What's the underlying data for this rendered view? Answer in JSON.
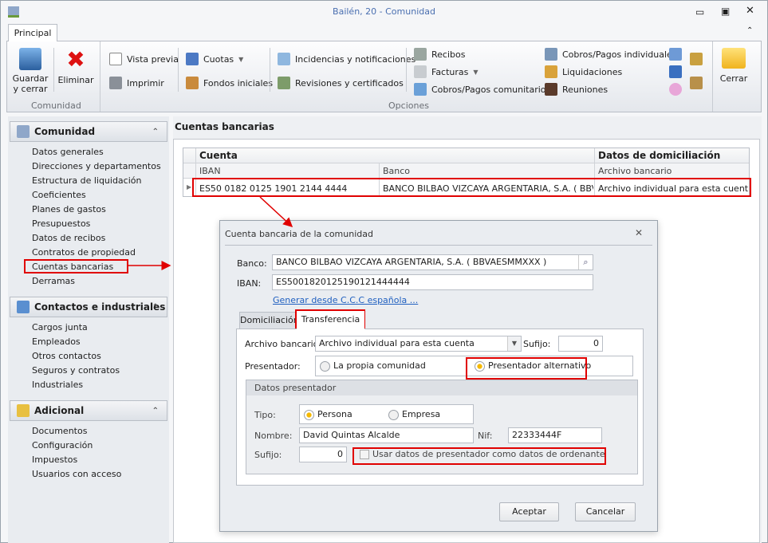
{
  "window": {
    "title": "Bailén, 20 - Comunidad",
    "tab": "Principal"
  },
  "ribbon": {
    "guardar": "Guardar y cerrar",
    "eliminar": "Eliminar",
    "group1": "Comunidad",
    "vista_previa": "Vista previa",
    "imprimir": "Imprimir",
    "cuotas": "Cuotas",
    "fondos": "Fondos iniciales",
    "incidencias": "Incidencias y notificaciones",
    "revisiones": "Revisiones y certificados",
    "recibos": "Recibos",
    "facturas": "Facturas",
    "cobros_com": "Cobros/Pagos comunitarios",
    "cobros_ind": "Cobros/Pagos individuales",
    "liquidaciones": "Liquidaciones",
    "reuniones": "Reuniones",
    "group2": "Opciones",
    "cerrar": "Cerrar"
  },
  "sidebar": [
    {
      "title": "Comunidad",
      "items": [
        "Datos generales",
        "Direcciones y departamentos",
        "Estructura de liquidación",
        "Coeficientes",
        "Planes de gastos",
        "Presupuestos",
        "Datos de recibos",
        "Contratos de propiedad",
        "Cuentas bancarias",
        "Derramas"
      ]
    },
    {
      "title": "Contactos e industriales",
      "items": [
        "Cargos junta",
        "Empleados",
        "Otros contactos",
        "Seguros y contratos",
        "Industriales"
      ]
    },
    {
      "title": "Adicional",
      "items": [
        "Documentos",
        "Configuración",
        "Impuestos",
        "Usuarios con acceso"
      ]
    }
  ],
  "main": {
    "title": "Cuentas bancarias",
    "grid": {
      "band1": "Cuenta",
      "band2": "Datos de domiciliación",
      "cols": [
        "IBAN",
        "Banco",
        "Archivo bancario"
      ],
      "rows": [
        [
          "ES50 0182 0125 1901 2144 4444",
          "BANCO BILBAO VIZCAYA ARGENTARIA, S.A. ( BBV...",
          "Archivo individual para esta cuenta"
        ]
      ]
    }
  },
  "dialog": {
    "title": "Cuenta bancaria de la comunidad",
    "banco_label": "Banco:",
    "banco": "BANCO BILBAO VIZCAYA ARGENTARIA, S.A. ( BBVAESMMXXX )",
    "iban_label": "IBAN:",
    "iban": "ES5001820125190121444444",
    "link": "Generar desde C.C.C española ...",
    "tabs": [
      "Domiciliación",
      "Transferencia"
    ],
    "archivo_label": "Archivo bancario:",
    "archivo": "Archivo individual para esta cuenta",
    "sufijo_label": "Sufijo:",
    "sufijo": "0",
    "presentador_label": "Presentador:",
    "opt1": "La propia comunidad",
    "opt2": "Presentador alternativo",
    "group": "Datos presentador",
    "tipo_label": "Tipo:",
    "tipo1": "Persona",
    "tipo2": "Empresa",
    "nombre_label": "Nombre:",
    "nombre": "David Quintas Alcalde",
    "nif_label": "Nif:",
    "nif": "22333444F",
    "sufijo2_label": "Sufijo:",
    "sufijo2": "0",
    "checkbox": "Usar datos de presentador como datos de ordenante",
    "aceptar": "Aceptar",
    "cancelar": "Cancelar"
  }
}
